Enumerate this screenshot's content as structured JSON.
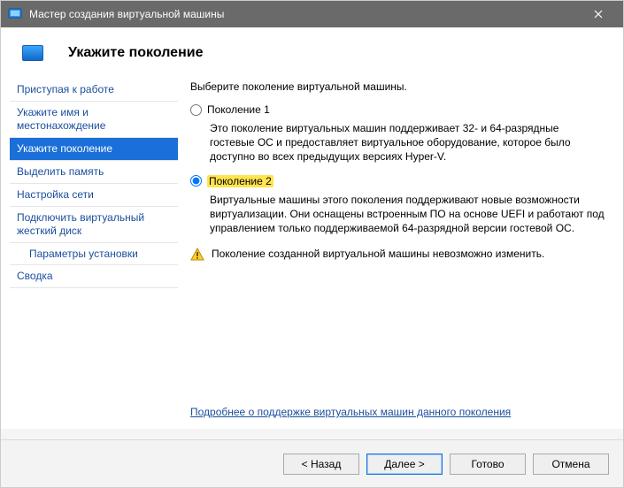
{
  "window": {
    "title": "Мастер создания виртуальной машины"
  },
  "header": {
    "title": "Укажите поколение"
  },
  "sidebar": {
    "items": [
      {
        "label": "Приступая к работе"
      },
      {
        "label": "Укажите имя и местонахождение"
      },
      {
        "label": "Укажите поколение"
      },
      {
        "label": "Выделить память"
      },
      {
        "label": "Настройка сети"
      },
      {
        "label": "Подключить виртуальный жесткий диск"
      },
      {
        "label": "Параметры установки"
      },
      {
        "label": "Сводка"
      }
    ]
  },
  "content": {
    "intro": "Выберите поколение виртуальной машины.",
    "gen1": {
      "label": "Поколение 1",
      "desc": "Это поколение виртуальных машин поддерживает 32- и 64-разрядные гостевые ОС и предоставляет виртуальное оборудование, которое было доступно во всех предыдущих версиях Hyper-V."
    },
    "gen2": {
      "label": "Поколение 2",
      "desc": "Виртуальные машины этого поколения поддерживают новые возможности виртуализации. Они оснащены встроенным ПО на основе UEFI и работают под управлением только поддерживаемой 64-разрядной версии гостевой ОС."
    },
    "warning": "Поколение созданной виртуальной машины невозможно изменить.",
    "link": "Подробнее о поддержке виртуальных машин данного поколения"
  },
  "footer": {
    "back": "< Назад",
    "next": "Далее >",
    "finish": "Готово",
    "cancel": "Отмена"
  }
}
